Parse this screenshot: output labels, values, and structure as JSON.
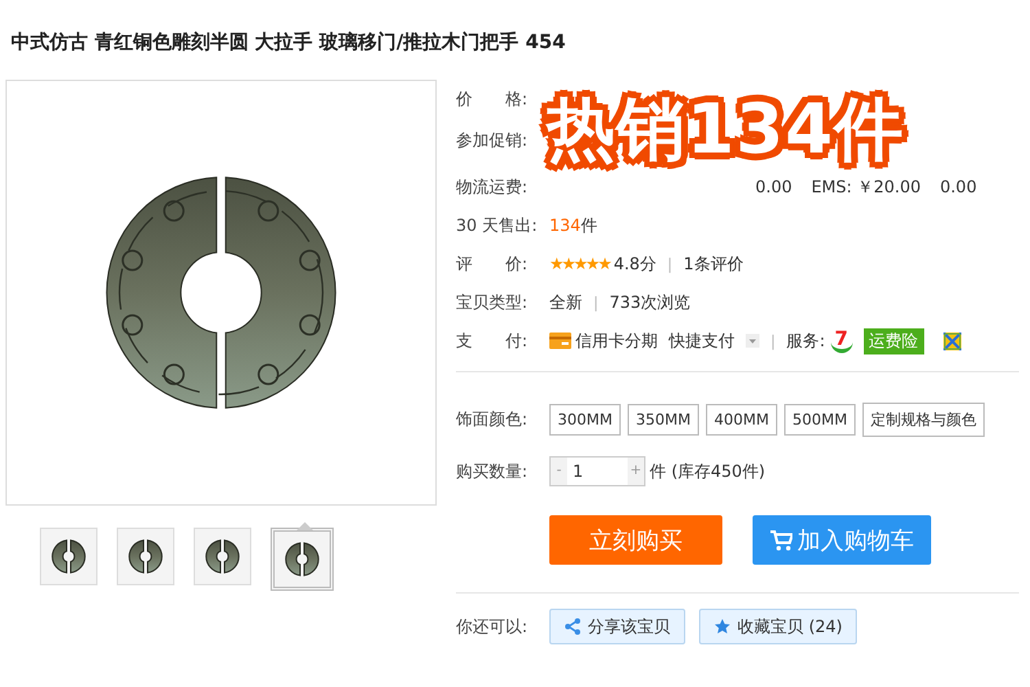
{
  "title": "中式仿古 青红铜色雕刻半圆 大拉手 玻璃移门/推拉木门把手 454",
  "gallery": {
    "thumbnails": [
      {
        "selected": false
      },
      {
        "selected": false
      },
      {
        "selected": false
      },
      {
        "selected": true
      }
    ]
  },
  "overlay_badge": "热销134件",
  "info": {
    "price": {
      "label": "价　　格:"
    },
    "promotion": {
      "label": "参加促销:"
    },
    "shipping": {
      "label": "物流运费:",
      "options": [
        "0.00",
        "EMS: ￥20.00",
        "0.00"
      ]
    },
    "sold": {
      "label": "30 天售出:",
      "count": "134",
      "unit": "件"
    },
    "rating": {
      "label": "评　　价:",
      "stars": 5,
      "score": "4.8分",
      "separator": "|",
      "reviews": "1条评价"
    },
    "type": {
      "label": "宝贝类型:",
      "condition": "全新",
      "separator": "|",
      "views": "733次浏览"
    },
    "payment": {
      "label": "支　　付:",
      "methods": [
        "信用卡分期",
        "快捷支付"
      ],
      "separator": "|",
      "service_label": "服务:",
      "services": [
        {
          "kind": "seven",
          "text": "7"
        },
        {
          "kind": "tag",
          "text": "运费险"
        },
        {
          "kind": "icon"
        }
      ]
    },
    "finish": {
      "label": "饰面颜色:",
      "options": [
        {
          "label": "300MM",
          "selected": false
        },
        {
          "label": "350MM",
          "selected": false
        },
        {
          "label": "400MM",
          "selected": false
        },
        {
          "label": "500MM",
          "selected": false
        },
        {
          "label": "定制规格与颜色",
          "selected": false
        }
      ]
    },
    "quantity": {
      "label": "购买数量:",
      "minus": "-",
      "value": "1",
      "plus": "+",
      "stock": "件 (库存450件)"
    }
  },
  "buttons": {
    "buy": "立刻购买",
    "cart": "加入购物车"
  },
  "more": {
    "label": "你还可以:",
    "share": "分享该宝贝",
    "favorite": "收藏宝贝 (24)"
  }
}
